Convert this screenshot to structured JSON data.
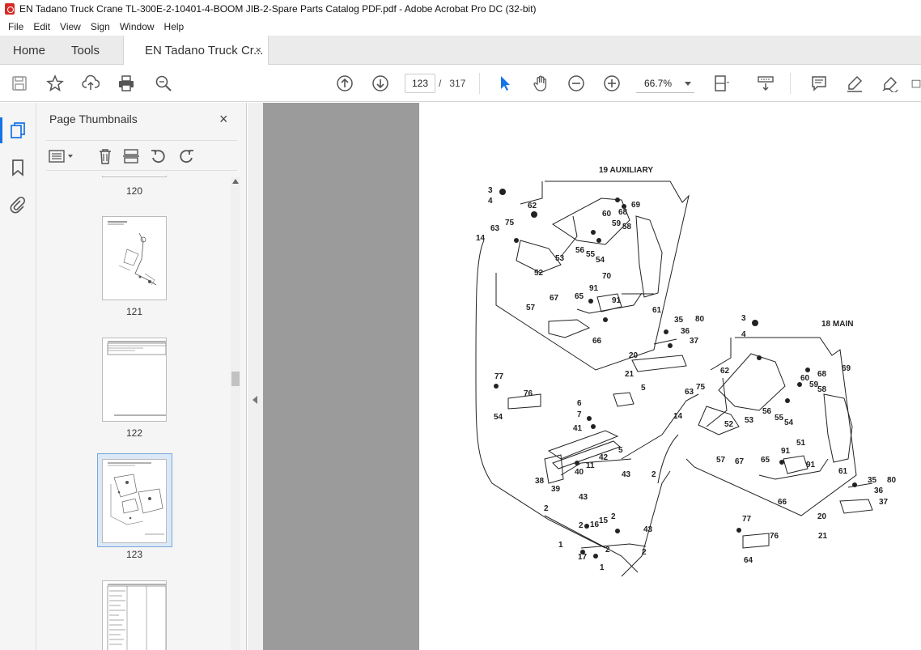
{
  "window": {
    "title": "EN Tadano Truck Crane TL-300E-2-10401-4-BOOM JIB-2-Spare Parts Catalog PDF.pdf - Adobe Acrobat Pro DC (32-bit)"
  },
  "menu": {
    "items": [
      "File",
      "Edit",
      "View",
      "Sign",
      "Window",
      "Help"
    ]
  },
  "tabs": {
    "home": "Home",
    "tools": "Tools",
    "document": "EN Tadano Truck Cr...",
    "close": "×"
  },
  "toolbar": {
    "current_page": "123",
    "page_separator": "/",
    "total_pages": "317",
    "zoom": "66.7%"
  },
  "panel": {
    "title": "Page Thumbnails",
    "close": "×",
    "thumbnails": [
      {
        "label": "120"
      },
      {
        "label": "121"
      },
      {
        "label": "122"
      },
      {
        "label": "123",
        "selected": true
      },
      {
        "label": ""
      }
    ]
  },
  "diagram": {
    "aux_header": "19  AUXILIARY",
    "main_header": "18  MAIN",
    "labels": [
      {
        "t": "3",
        "k": "a1"
      },
      {
        "t": "4",
        "k": "a2"
      },
      {
        "t": "62",
        "k": "a3"
      },
      {
        "t": "69",
        "k": "a4"
      },
      {
        "t": "60",
        "k": "a5"
      },
      {
        "t": "68",
        "k": "a6"
      },
      {
        "t": "59",
        "k": "a7"
      },
      {
        "t": "58",
        "k": "a8"
      },
      {
        "t": "63",
        "k": "a9"
      },
      {
        "t": "75",
        "k": "a10"
      },
      {
        "t": "14",
        "k": "a11"
      },
      {
        "t": "53",
        "k": "a12"
      },
      {
        "t": "56",
        "k": "a13"
      },
      {
        "t": "55",
        "k": "a14"
      },
      {
        "t": "54",
        "k": "a15"
      },
      {
        "t": "52",
        "k": "a16"
      },
      {
        "t": "70",
        "k": "a17"
      },
      {
        "t": "91",
        "k": "a18"
      },
      {
        "t": "91",
        "k": "a19"
      },
      {
        "t": "57",
        "k": "a20"
      },
      {
        "t": "67",
        "k": "a21"
      },
      {
        "t": "65",
        "k": "a22"
      },
      {
        "t": "61",
        "k": "a23"
      },
      {
        "t": "35",
        "k": "a24"
      },
      {
        "t": "80",
        "k": "a25"
      },
      {
        "t": "36",
        "k": "a26"
      },
      {
        "t": "37",
        "k": "a27"
      },
      {
        "t": "66",
        "k": "a28"
      },
      {
        "t": "20",
        "k": "a29"
      },
      {
        "t": "21",
        "k": "a30"
      },
      {
        "t": "77",
        "k": "b1"
      },
      {
        "t": "76",
        "k": "b2"
      },
      {
        "t": "54",
        "k": "b3"
      },
      {
        "t": "5",
        "k": "b4"
      },
      {
        "t": "6",
        "k": "b5"
      },
      {
        "t": "7",
        "k": "b6"
      },
      {
        "t": "41",
        "k": "b7"
      },
      {
        "t": "42",
        "k": "b8"
      },
      {
        "t": "5",
        "k": "b9"
      },
      {
        "t": "11",
        "k": "b10"
      },
      {
        "t": "40",
        "k": "b11"
      },
      {
        "t": "38",
        "k": "b12"
      },
      {
        "t": "39",
        "k": "b13"
      },
      {
        "t": "43",
        "k": "b14"
      },
      {
        "t": "2",
        "k": "b15"
      },
      {
        "t": "43",
        "k": "b16"
      },
      {
        "t": "2",
        "k": "b17"
      },
      {
        "t": "2",
        "k": "b18"
      },
      {
        "t": "16",
        "k": "b19"
      },
      {
        "t": "15",
        "k": "b20"
      },
      {
        "t": "2",
        "k": "b21"
      },
      {
        "t": "43",
        "k": "b22"
      },
      {
        "t": "1",
        "k": "b23"
      },
      {
        "t": "17",
        "k": "b24"
      },
      {
        "t": "2",
        "k": "b25"
      },
      {
        "t": "2",
        "k": "b26"
      },
      {
        "t": "1",
        "k": "b27"
      },
      {
        "t": "3",
        "k": "m1"
      },
      {
        "t": "4",
        "k": "m2"
      },
      {
        "t": "62",
        "k": "m3"
      },
      {
        "t": "69",
        "k": "m4"
      },
      {
        "t": "68",
        "k": "m5"
      },
      {
        "t": "60",
        "k": "m6"
      },
      {
        "t": "59",
        "k": "m7"
      },
      {
        "t": "58",
        "k": "m8"
      },
      {
        "t": "75",
        "k": "m9"
      },
      {
        "t": "63",
        "k": "m10"
      },
      {
        "t": "14",
        "k": "m11"
      },
      {
        "t": "52",
        "k": "m12"
      },
      {
        "t": "53",
        "k": "m13"
      },
      {
        "t": "56",
        "k": "m14"
      },
      {
        "t": "55",
        "k": "m15"
      },
      {
        "t": "54",
        "k": "m16"
      },
      {
        "t": "51",
        "k": "m17"
      },
      {
        "t": "91",
        "k": "m18"
      },
      {
        "t": "91",
        "k": "m19"
      },
      {
        "t": "57",
        "k": "m20"
      },
      {
        "t": "67",
        "k": "m21"
      },
      {
        "t": "65",
        "k": "m22"
      },
      {
        "t": "61",
        "k": "m23"
      },
      {
        "t": "35",
        "k": "m24"
      },
      {
        "t": "80",
        "k": "m25"
      },
      {
        "t": "36",
        "k": "m26"
      },
      {
        "t": "37",
        "k": "m27"
      },
      {
        "t": "66",
        "k": "m28"
      },
      {
        "t": "20",
        "k": "m29"
      },
      {
        "t": "21",
        "k": "m30"
      },
      {
        "t": "77",
        "k": "m31"
      },
      {
        "t": "76",
        "k": "m32"
      },
      {
        "t": "64",
        "k": "m33"
      }
    ]
  }
}
